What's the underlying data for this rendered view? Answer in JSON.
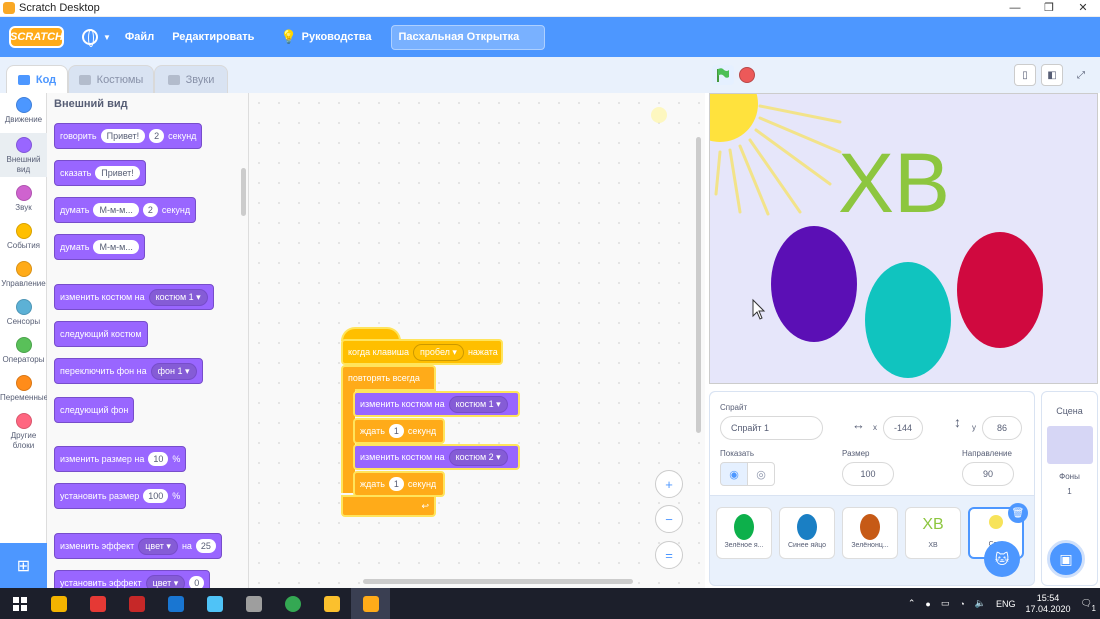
{
  "window": {
    "title": "Scratch Desktop",
    "controls": [
      "—",
      "❐",
      "✕"
    ]
  },
  "menubar": {
    "logo": "SCRATCH",
    "file": "Файл",
    "edit": "Редактировать",
    "tutorials": "Руководства",
    "project_title": "Пасхальная Открытка"
  },
  "tabs": {
    "code": "Код",
    "costumes": "Костюмы",
    "sounds": "Звуки"
  },
  "categories": [
    {
      "label": "Движение",
      "color": "#4c97ff"
    },
    {
      "label": "Внешний вид",
      "color": "#9966ff"
    },
    {
      "label": "Звук",
      "color": "#cf63cf"
    },
    {
      "label": "События",
      "color": "#ffbf00"
    },
    {
      "label": "Управление",
      "color": "#ffab19"
    },
    {
      "label": "Сенсоры",
      "color": "#5cb1d6"
    },
    {
      "label": "Операторы",
      "color": "#59c059"
    },
    {
      "label": "Переменные",
      "color": "#ff8c1a"
    },
    {
      "label": "Другие блоки",
      "color": "#ff6680"
    }
  ],
  "palette": {
    "heading": "Внешний вид",
    "say_secs": {
      "a": "говорить",
      "msg": "Привет!",
      "secs": "2",
      "b": "секунд"
    },
    "say": {
      "a": "сказать",
      "msg": "Привет!"
    },
    "think_secs": {
      "a": "думать",
      "msg": "М-м-м...",
      "secs": "2",
      "b": "секунд"
    },
    "think": {
      "a": "думать",
      "msg": "М-м-м..."
    },
    "switch_costume": {
      "a": "изменить костюм на",
      "val": "костюм 1"
    },
    "next_costume": "следующий костюм",
    "switch_backdrop": {
      "a": "переключить фон на",
      "val": "фон 1"
    },
    "next_backdrop": "следующий фон",
    "change_size": {
      "a": "изменить размер на",
      "val": "10",
      "b": "%"
    },
    "set_size": {
      "a": "установить размер",
      "val": "100",
      "b": "%"
    },
    "change_effect": {
      "a": "изменить эффект",
      "effect": "цвет",
      "b": "на",
      "val": "25"
    },
    "set_effect": {
      "a": "установить эффект",
      "effect": "цвет",
      "val": "0"
    }
  },
  "script": {
    "hat": {
      "a": "когда клавиша",
      "key": "пробел",
      "b": "нажата"
    },
    "forever": "повторять всегда",
    "costume1": {
      "a": "изменить костюм на",
      "val": "костюм 1"
    },
    "wait1": {
      "a": "ждать",
      "val": "1",
      "b": "секунд"
    },
    "costume2": {
      "a": "изменить костюм на",
      "val": "костюм 2"
    },
    "wait2": {
      "a": "ждать",
      "val": "1",
      "b": "секунд"
    }
  },
  "zoom": {
    "in": "+",
    "out": "−",
    "reset": "="
  },
  "stage": {
    "text": "ХВ",
    "egg_colors": [
      "#5b0fb5",
      "#10c4bf",
      "#d0093f"
    ],
    "text_color": "#8dc63f"
  },
  "sprite_info": {
    "sprite_label": "Спрайт",
    "sprite_name": "Спрайт 1",
    "x_label": "x",
    "x_value": "-144",
    "y_label": "y",
    "y_value": "86",
    "show_label": "Показать",
    "size_label": "Размер",
    "size_value": "100",
    "direction_label": "Направление",
    "direction_value": "90"
  },
  "sprites": [
    {
      "name": "Зелёное я...",
      "color": "#0db04b"
    },
    {
      "name": "Синее яйцо",
      "color": "#1a7fc4"
    },
    {
      "name": "Зелёнонц...",
      "color": "#c65a16"
    },
    {
      "name": "ХВ",
      "color": "#8dc63f"
    },
    {
      "name": "Сп...",
      "color": "#f7e35a"
    }
  ],
  "stage_panel": {
    "label": "Сцена",
    "backdrops_label": "Фоны",
    "backdrops_count": "1"
  },
  "taskbar": {
    "lang": "ENG",
    "time": "15:54",
    "date": "17.04.2020",
    "notif": "1"
  }
}
